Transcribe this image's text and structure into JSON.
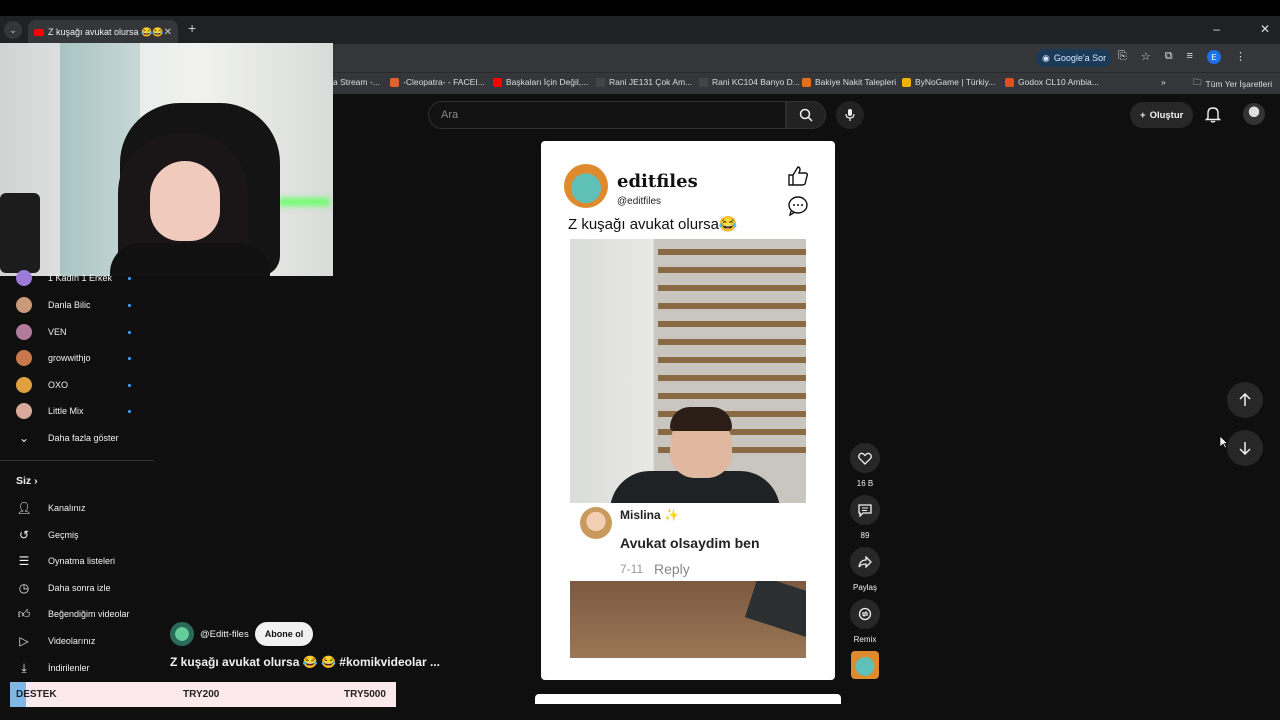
{
  "browser": {
    "tab_title": "Z kuşağı avukat olursa 😂😂",
    "google_ask": "Google'a Sor",
    "profile_letter": "E",
    "bookmarks": [
      {
        "label": "a Stream -...",
        "color": "#888888"
      },
      {
        "label": "-Cleopatra- - FACEI...",
        "color": "#e06030"
      },
      {
        "label": "Başkaları İçin Değil,...",
        "color": "#ff0000"
      },
      {
        "label": "Rani JE131 Çok Am...",
        "color": "#444444"
      },
      {
        "label": "Rani KC104 Banyo D...",
        "color": "#444444"
      },
      {
        "label": "Bakiye Nakit Talepleri",
        "color": "#e07020"
      },
      {
        "label": "ByNoGame | Türkiy...",
        "color": "#f0b000"
      },
      {
        "label": "Godox CL10 Ambia...",
        "color": "#e05020"
      }
    ],
    "all_bookmarks": "Tüm Yer İşaretleri"
  },
  "header": {
    "search_placeholder": "Ara",
    "create_label": "Oluştur"
  },
  "sidebar": {
    "subscriptions": [
      {
        "label": "1 Kadın 1 Erkek",
        "color": "#9b7ad8"
      },
      {
        "label": "Danla Bilic",
        "color": "#c89a7a"
      },
      {
        "label": "VEN",
        "color": "#b07a9a"
      },
      {
        "label": "growwithjo",
        "color": "#c8784a"
      },
      {
        "label": "OXO",
        "color": "#e0a040"
      },
      {
        "label": "Little Mix",
        "color": "#d8a89a"
      }
    ],
    "show_more": "Daha fazla göster",
    "you_section": "Siz",
    "you_items": [
      {
        "label": "Kanalınız",
        "icon": "person-icon"
      },
      {
        "label": "Geçmiş",
        "icon": "history-icon"
      },
      {
        "label": "Oynatma listeleri",
        "icon": "playlist-icon"
      },
      {
        "label": "Daha sonra izle",
        "icon": "clock-icon"
      },
      {
        "label": "Beğendiğim videolar",
        "icon": "like-icon"
      },
      {
        "label": "Videolarınız",
        "icon": "video-icon"
      },
      {
        "label": "İndirilenler",
        "icon": "download-icon"
      }
    ]
  },
  "short": {
    "channel_name": "editfiles",
    "channel_handle": "@editfiles",
    "title": "Z kuşağı avukat olursa😂",
    "comment": {
      "author": "Mislina ✨",
      "text": "Avukat olsaydim ben",
      "time": "7-11",
      "reply": "Reply"
    }
  },
  "actions": {
    "likes": "16 B",
    "comments": "89",
    "share": "Paylaş",
    "remix": "Remix"
  },
  "video_info": {
    "channel": "@Editt-files",
    "subscribe": "Abone ol",
    "title": "Z kuşağı avukat olursa 😂 😂 #komikvideolar ..."
  },
  "donation": {
    "label": "DESTEK",
    "amount": "TRY200",
    "goal": "TRY5000"
  }
}
